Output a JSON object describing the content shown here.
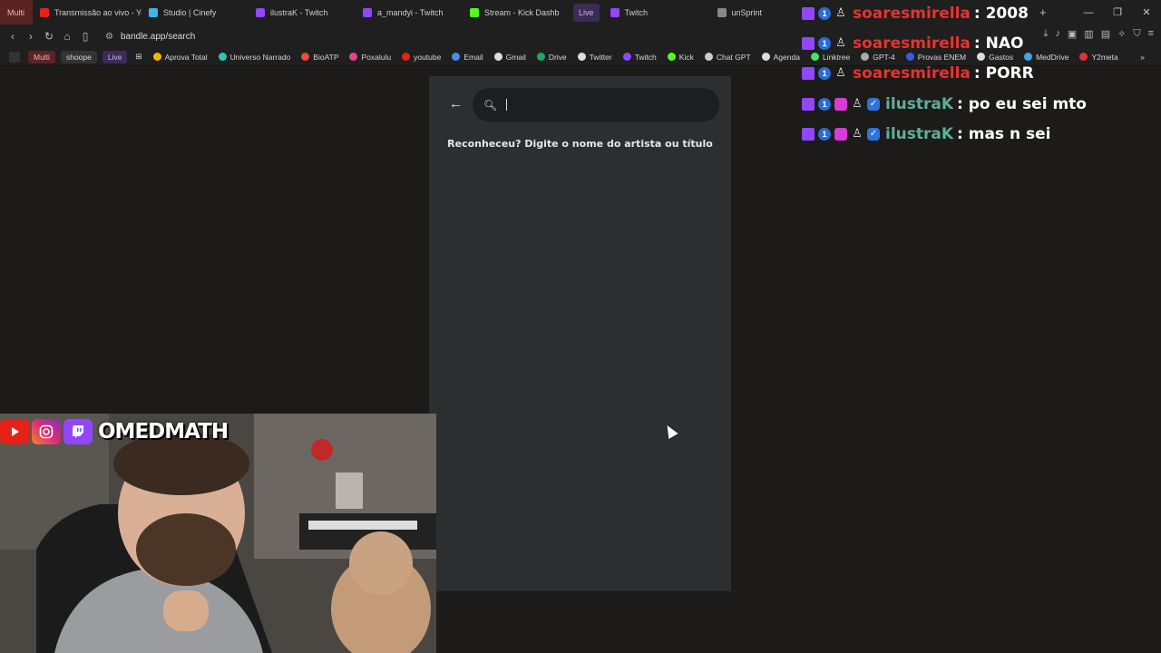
{
  "browser": {
    "tabs": [
      {
        "label": "Multi",
        "type": "group-multi"
      },
      {
        "label": "Transmissão ao vivo - Yo",
        "favicon_color": "#e62117"
      },
      {
        "label": "Studio | Cinefy",
        "favicon_color": "#3fb6e8"
      },
      {
        "label": "ilustraK - Twitch",
        "favicon_color": "#9146ff"
      },
      {
        "label": "a_mandyi - Twitch",
        "favicon_color": "#9146ff"
      },
      {
        "label": "Stream - Kick Dashb",
        "favicon_color": "#53fc18"
      },
      {
        "label": "Live",
        "type": "group-live"
      },
      {
        "label": "Twitch",
        "favicon_color": "#9146ff"
      },
      {
        "label": "unSprint",
        "favicon_color": "#888888"
      }
    ],
    "url": "bandle.app/search",
    "bookmarks": [
      {
        "label": "Multi",
        "type": "pill-multi"
      },
      {
        "label": "shoope",
        "type": "pill-shoope"
      },
      {
        "label": "Live",
        "type": "pill-live"
      },
      {
        "label": "Aprova Total",
        "color": "#f5b400"
      },
      {
        "label": "Universo Narrado",
        "color": "#2ec4b6"
      },
      {
        "label": "BioATP",
        "color": "#e74c3c"
      },
      {
        "label": "Poxalulu",
        "color": "#e84393"
      },
      {
        "label": "youtube",
        "color": "#e62117"
      },
      {
        "label": "Email",
        "color": "#4a8af4"
      },
      {
        "label": "Gmail",
        "color": "#dddddd"
      },
      {
        "label": "Drive",
        "color": "#1fa463"
      },
      {
        "label": "Twitter",
        "color": "#dddddd"
      },
      {
        "label": "Twitch",
        "color": "#9146ff"
      },
      {
        "label": "Kick",
        "color": "#53fc18"
      },
      {
        "label": "Chat GPT",
        "color": "#cccccc"
      },
      {
        "label": "Agenda",
        "color": "#dddddd"
      },
      {
        "label": "Linktree",
        "color": "#43e55e"
      },
      {
        "label": "GPT-4",
        "color": "#aaaaaa"
      },
      {
        "label": "Provas ENEM",
        "color": "#3b5bdb"
      },
      {
        "label": "Gastos",
        "color": "#dddddd"
      },
      {
        "label": "MedDrive",
        "color": "#3fa7e6"
      },
      {
        "label": "Y2meta",
        "color": "#e03131"
      }
    ]
  },
  "page": {
    "search": {
      "value": "",
      "placeholder": ""
    },
    "hint": "Reconheceu? Digite o nome do artista ou título"
  },
  "chat": [
    {
      "user": "soaresmirella",
      "user_color": "#e8322f",
      "badges": [
        "twitch",
        "one",
        "user"
      ],
      "message": ": 2008"
    },
    {
      "user": "soaresmirella",
      "user_color": "#e8322f",
      "badges": [
        "twitch",
        "one",
        "user"
      ],
      "message": ": NAO"
    },
    {
      "user": "soaresmirella",
      "user_color": "#e8322f",
      "badges": [
        "twitch",
        "one",
        "user"
      ],
      "message": ": PORR"
    },
    {
      "user": "ilustraK",
      "user_color": "#5fae9a",
      "badges": [
        "twitch",
        "one",
        "heart",
        "user",
        "check"
      ],
      "message": ": po eu sei mto"
    },
    {
      "user": "ilustraK",
      "user_color": "#5fae9a",
      "badges": [
        "twitch",
        "one",
        "heart",
        "user",
        "check"
      ],
      "message": ": mas n sei"
    }
  ],
  "stream": {
    "brand": "OMEDMATH",
    "icons": [
      "youtube-icon",
      "instagram-icon",
      "twitch-icon"
    ]
  }
}
